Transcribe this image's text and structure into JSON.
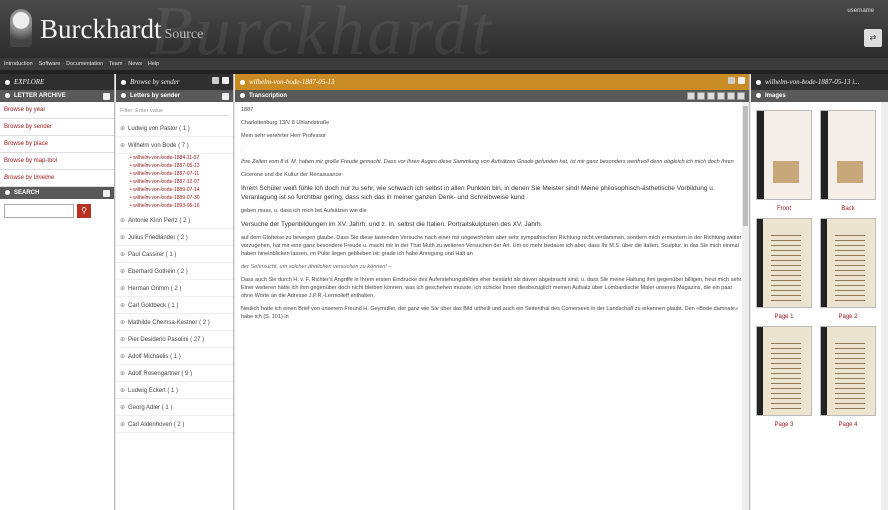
{
  "header": {
    "app_name": "Burckhardt",
    "app_suffix": "Source",
    "signature": "Burckhardt",
    "user": "username",
    "user_button": "⇄"
  },
  "topnav": [
    "Introduction",
    "Software",
    "Documentation",
    "Team",
    "News",
    "Help"
  ],
  "explore": {
    "title": "EXPLORE",
    "archive_title": "LETTER ARCHIVE",
    "items": [
      "Browse by year",
      "Browse by sender",
      "Browse by place",
      "Browse by map-tool",
      "Browse by timeline"
    ],
    "search_title": "SEARCH",
    "search_icon": "search-icon"
  },
  "sender_panel": {
    "title": "Browse by sender",
    "subheader": "Letters by sender",
    "filter_placeholder": "Filter: Enter value",
    "senders_top": [
      {
        "name": "Ludwig von Pastor",
        "count": "( 1 )"
      },
      {
        "name": "Wilhelm von Bode",
        "count": "( 7 )"
      }
    ],
    "letters": [
      "wilhelm-von-bode-1884-11-07",
      "wilhelm-von-bode-1887-05-13",
      "wilhelm-von-bode-1887-07-11",
      "wilhelm-von-bode-1887-12-07",
      "wilhelm-von-bode-1889-07-14",
      "wilhelm-von-bode-1889-07-30",
      "wilhelm-von-bode-1893-05-16"
    ],
    "senders_rest": [
      {
        "name": "Antonie Kinn Pertz",
        "count": "( 2 )"
      },
      {
        "name": "Julius Friedländer",
        "count": "( 2 )"
      },
      {
        "name": "Paul Cassirer",
        "count": "( 1 )"
      },
      {
        "name": "Eberhard Gothein",
        "count": "( 2 )"
      },
      {
        "name": "Herman Grimm",
        "count": "( 2 )"
      },
      {
        "name": "Carl Goldbeck",
        "count": "( 1 )"
      },
      {
        "name": "Mathilde Chemsa-Kestner",
        "count": "( 2 )"
      },
      {
        "name": "Pier Desiderio Pasolini",
        "count": "( 27 )"
      },
      {
        "name": "Adolf Michaelis",
        "count": "( 1 )"
      },
      {
        "name": "Adolf Rosengartner",
        "count": "( 9 )"
      },
      {
        "name": "Ludwig Eckert",
        "count": "( 1 )"
      },
      {
        "name": "Georg Adler",
        "count": "( 1 )"
      },
      {
        "name": "Carl Aldenhoven",
        "count": "( 2 )"
      }
    ]
  },
  "transcription_panel": {
    "title": "wilhelm-von-bode-1887-05-13",
    "subheader": "Transcription",
    "lines": [
      {
        "style": "normal",
        "text": "1887"
      },
      {
        "style": "normal",
        "text": "Charlottenburg 13/V 8 Uhlandstraße"
      },
      {
        "style": "normal",
        "text": "Mein sehr verehrter Herr Professor"
      },
      {
        "style": "normal",
        "text": "."
      },
      {
        "style": "em",
        "text": "Ihre Zeilen vom 8 d. M. haben mir große Freude gemacht. Dass vor Ihren Augen diese Sammlung von Aufsätzen Gnade gefunden hat, ist mir ganz besonders werthvoll denn obgleich ich mich doch Ihren"
      },
      {
        "style": "normal",
        "text": "Cicerone und die Kultur der Renaissance"
      },
      {
        "style": "big",
        "text": "Ihrem Schüler weiß fühle ich doch nur zu sehr, wie schwach ich selbst in allen Punkten bin, in denen Sie Meister sind! Meine philosophisch-ästhetische Vorbildung u. Veranlagung ist so furchtbar gering, dass sich das in meiner ganzen Denk- und Schreibweise kund"
      },
      {
        "style": "normal",
        "text": "geben muss, u. dass ich mich bei Aufsätzen wie die"
      },
      {
        "style": "big",
        "text": "Versuche der Typenbildungen im XV. Jahrh. und z. In. selbst die Italien. Portraitskulpturen des XV. Jahrh."
      },
      {
        "style": "normal",
        "text": "auf dem Glatteise zu bewegen glaube. Dass Sie diese tastenden Versuche nach einer mir ungewohnten aber sehr sympathischen Richtung nicht verdammen, sondern mich ermuntern in der Richtung weiter vorzugehen, hat mir eine ganz besondere Freude u. macht mir in der That Muth zu weiteren Versuchen der Art. Um so mehr bedaure ich aber, dass Ihr M.S. über die italien. Sculptur, in das Sie mich einmal haben hineinblicken lassen, im Pulte liegen geblieben ist; grade ich habe Anregung und Halt an"
      },
      {
        "style": "note",
        "text": "der Sehnsucht, um solcher ähnlichen versuchen zu können! –"
      },
      {
        "style": "normal",
        "text": "Dass auch Sie durch H. v. F. Richter's Angriffe in Ihrem ersten Eindrucke des Auferstehungsbildes eher bestärkt als davon abgebracht sind, u. dass Sie meine Haltung ihm gegenüber billigen, freut mich sehr. Einer weiteren hätte ich ihm gegenüber doch nicht bleiben können, was ich geschehen musste; ich schicke Ihnen diesbezüglich meinen Aufsatz über Lombardische Maler unseres Magazins, die ein paar ohne Worte an die Adresse J.P.R.-Lermolieff enthalten."
      },
      {
        "style": "normal",
        "text": "Neulich hatte ich einen Brief von unserem Freund H. Geymüller, der ganz wie Sie über das Bild urtheilt und auch ein Seitenthal des Comersees in der Landschaft zu erkennen glaubt. Den «Bode damnate» habe ich (S. 101) in"
      }
    ]
  },
  "images_panel": {
    "title": "wilhelm-von-bode-1887-05-13 i...",
    "subheader": "Images",
    "thumbs": [
      {
        "caption": "Front",
        "kind": "envelope"
      },
      {
        "caption": "Back",
        "kind": "envelope"
      },
      {
        "caption": "Page 1",
        "kind": "page"
      },
      {
        "caption": "Page 2",
        "kind": "page"
      },
      {
        "caption": "Page 3",
        "kind": "page"
      },
      {
        "caption": "Page 4",
        "kind": "page"
      }
    ]
  }
}
